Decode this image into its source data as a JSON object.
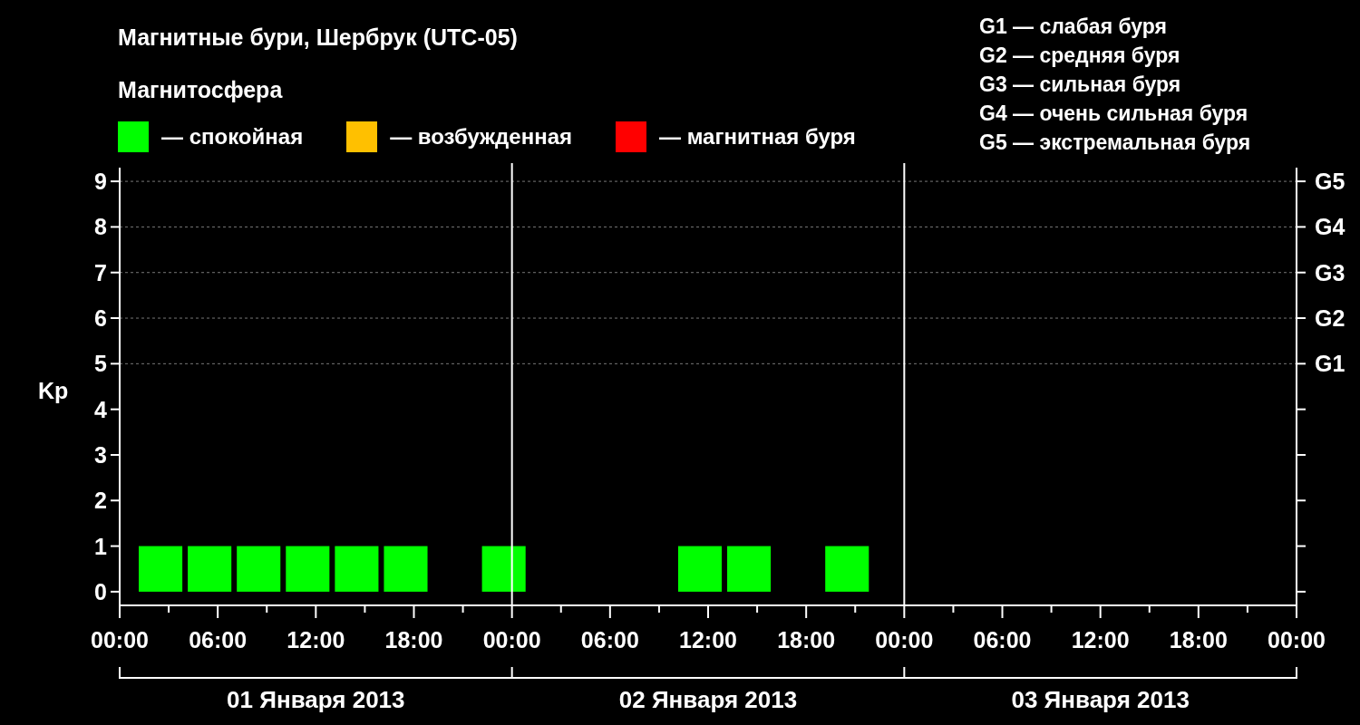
{
  "title": "Магнитные бури, Шербрук (UTC-05)",
  "subtitle": "Магнитосфера",
  "legend": [
    {
      "label": "— спокойная",
      "color": "#00ff00"
    },
    {
      "label": "— возбужденная",
      "color": "#ffc000"
    },
    {
      "label": "— магнитная буря",
      "color": "#ff0000"
    }
  ],
  "storm_scale": [
    "G1 — слабая буря",
    "G2 — средняя буря",
    "G3 — сильная буря",
    "G4 — очень сильная буря",
    "G5 — экстремальная буря"
  ],
  "chart": {
    "chart_data": {
      "type": "bar",
      "ylabel": "Kp",
      "x": [
        "2013-01-01T02:30",
        "2013-01-01T05:30",
        "2013-01-01T08:30",
        "2013-01-01T11:30",
        "2013-01-01T14:30",
        "2013-01-01T17:30",
        "2013-01-01T23:30",
        "2013-01-02T11:30",
        "2013-01-02T14:30",
        "2013-01-02T20:30"
      ],
      "series": [
        {
          "color": "#00ff00",
          "values": [
            1,
            1,
            1,
            1,
            1,
            1,
            1,
            1,
            1,
            1
          ]
        }
      ],
      "grid": true,
      "xlim": [
        "2013-01-01T00:00",
        "2013-01-04T00:00"
      ],
      "ylim": [
        -0.3,
        9.3
      ],
      "xticks": [
        {
          "value": "2013-01-01T00:00",
          "label": "00:00"
        },
        {
          "value": "2013-01-01T06:00",
          "label": "06:00"
        },
        {
          "value": "2013-01-01T12:00",
          "label": "12:00"
        },
        {
          "value": "2013-01-01T18:00",
          "label": "18:00"
        },
        {
          "value": "2013-01-02T00:00",
          "label": "00:00"
        },
        {
          "value": "2013-01-02T06:00",
          "label": "06:00"
        },
        {
          "value": "2013-01-02T12:00",
          "label": "12:00"
        },
        {
          "value": "2013-01-02T18:00",
          "label": "18:00"
        },
        {
          "value": "2013-01-03T00:00",
          "label": "00:00"
        },
        {
          "value": "2013-01-03T06:00",
          "label": "06:00"
        },
        {
          "value": "2013-01-03T12:00",
          "label": "12:00"
        },
        {
          "value": "2013-01-03T18:00",
          "label": "18:00"
        },
        {
          "value": "2013-01-04T00:00",
          "label": "00:00"
        }
      ],
      "yticks": [
        0,
        1,
        2,
        3,
        4,
        5,
        6,
        7,
        8,
        9
      ]
    },
    "right_axis": [
      "G5",
      "G4",
      "G3",
      "G2",
      "G1"
    ],
    "days": [
      "01 Января 2013",
      "02 Января 2013",
      "03 Января 2013"
    ]
  }
}
